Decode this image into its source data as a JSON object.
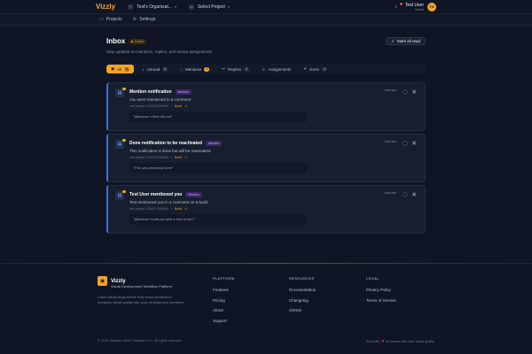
{
  "app": {
    "name": "Vizzly"
  },
  "topbar": {
    "org": "Test's Organizat...",
    "org_icon": "T",
    "project": "Select Project",
    "project_icon": "folder-icon",
    "user": {
      "name": "Test User",
      "role": "Owner",
      "initials": "TU"
    },
    "notification_badge": true
  },
  "subnav": [
    {
      "label": "Projects",
      "icon": "folder-icon"
    },
    {
      "label": "Settings",
      "icon": "gear-icon"
    }
  ],
  "inbox": {
    "title": "Inbox",
    "new_badge": "6 new",
    "subtitle": "Stay updated on mentions, replies, and review assignments",
    "mark_all_label": "Mark all read"
  },
  "tabs": [
    {
      "label": "All",
      "count": "6",
      "icon": "inbox-icon",
      "active": true
    },
    {
      "label": "Unread",
      "count": "6",
      "icon": "bell-icon"
    },
    {
      "label": "Mentions",
      "count": "3",
      "icon": "chat-icon"
    },
    {
      "label": "Replies",
      "count": "1",
      "icon": "reply-icon"
    },
    {
      "label": "Assignments",
      "count": "",
      "icon": "user-icon"
    },
    {
      "label": "Done",
      "count": "1",
      "icon": "check-icon"
    }
  ],
  "notifications": [
    {
      "title": "Mention notification",
      "tag": "Mention",
      "body": "You were mentioned in a comment",
      "meta": "test-project-1764447540946",
      "build": "Build",
      "quote": "\"@testuser check this out\"",
      "time": "Just now"
    },
    {
      "title": "Done notification to be reactivated",
      "tag": "Mention",
      "body": "This notification is done but will be reactivated",
      "meta": "test-project-1764447540946",
      "build": "Build",
      "quote": "\"This was previously done\"",
      "time": "Just now"
    },
    {
      "title": "Test User mentioned you",
      "tag": "Mention",
      "body": "Test mentioned you in a comment on a build",
      "meta": "test-project-1764447540946",
      "build": "Build",
      "quote": "\"@testuser could you take a look at this?\"",
      "time": "Just now"
    }
  ],
  "footer": {
    "brand": "Vizzly",
    "tagline": "Visual Development Workflow Platform",
    "description": "Catch visual bugs before they reach production. Integrate visual quality into your development workflow.",
    "columns": [
      {
        "heading": "PLATFORM",
        "links": [
          "Features",
          "Pricing",
          "About",
          "Support"
        ]
      },
      {
        "heading": "RESOURCES",
        "links": [
          "Documentation",
          "Changelog",
          "GitHub"
        ]
      },
      {
        "heading": "LEGAL",
        "links": [
          "Privacy Policy",
          "Terms of Service"
        ]
      }
    ],
    "copyright": "© 2025 Stubborn Mule Software LLC. All rights reserved.",
    "built_pre": "Built with",
    "built_post": "for teams who care about quality"
  },
  "colors": {
    "accent": "#f5a524",
    "card_border": "#3b6fd8",
    "mention_tag": "#c6a6ff"
  }
}
